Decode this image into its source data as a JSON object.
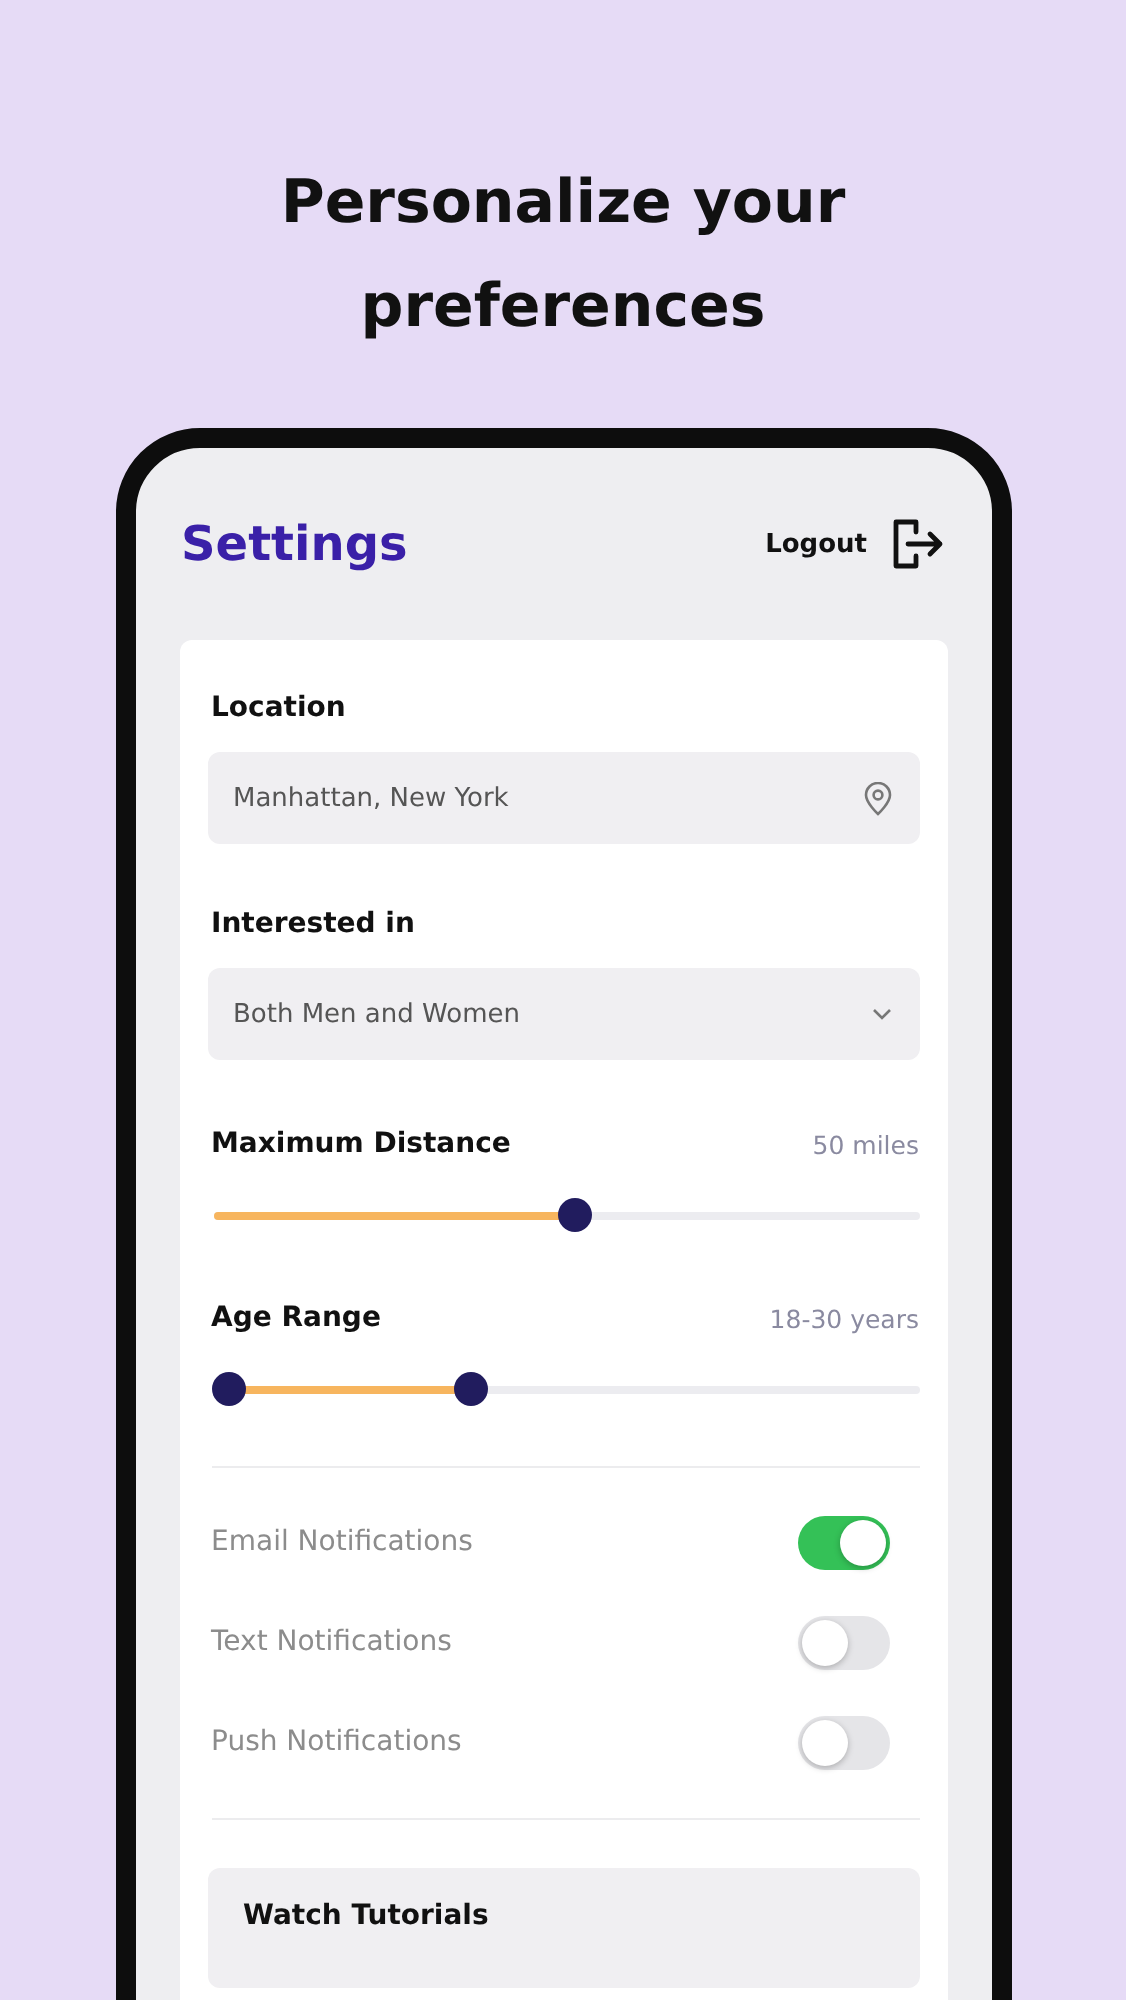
{
  "headline": "Personalize your preferences",
  "header": {
    "title": "Settings",
    "logout": "Logout"
  },
  "location": {
    "label": "Location",
    "value": "Manhattan, New York"
  },
  "interest": {
    "label": "Interested in",
    "value": "Both Men and Women"
  },
  "distance": {
    "label": "Maximum Distance",
    "reading": "50 miles",
    "level": 0.51
  },
  "age_range": {
    "label": "Age Range",
    "reading": "18-30 years",
    "thumbs": [
      {
        "level": 0
      },
      {
        "level": 0.35
      }
    ]
  },
  "notifications": [
    {
      "label": "Email Notifications",
      "on": true
    },
    {
      "label": "Text Notifications",
      "on": false
    },
    {
      "label": "Push Notifications",
      "on": false
    }
  ],
  "tutorials": {
    "label": "Watch Tutorials"
  }
}
